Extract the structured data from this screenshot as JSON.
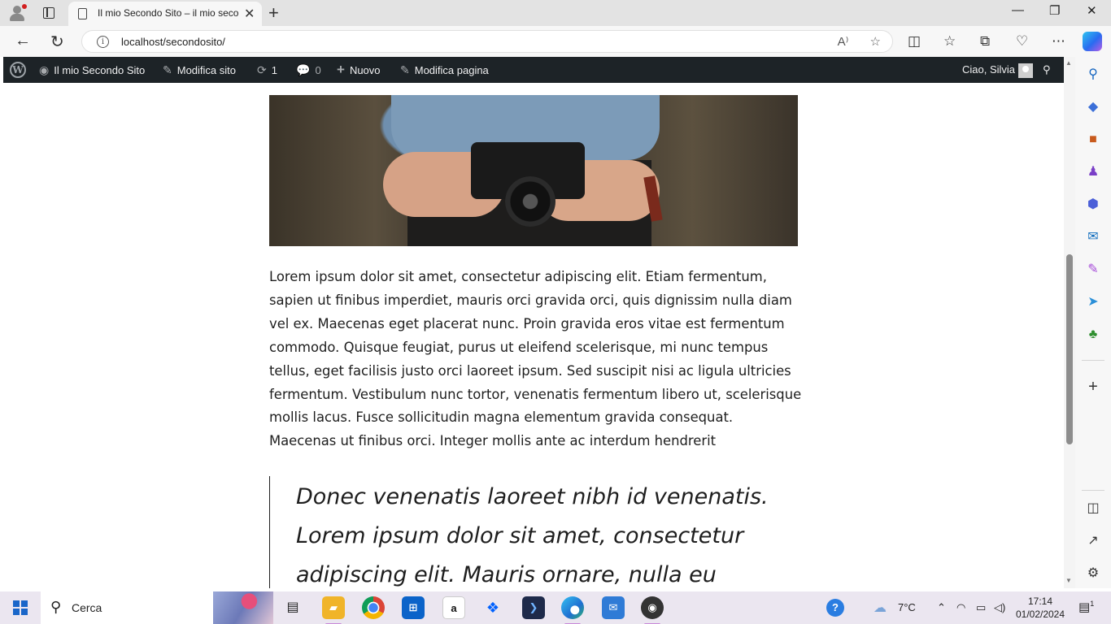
{
  "browser": {
    "tab_title": "Il mio Secondo Sito – il mio seco",
    "url": "localhost/secondosito/",
    "tab_close": "✕",
    "new_tab": "+",
    "win_minimize": "—",
    "win_restore": "❐",
    "win_close": "✕"
  },
  "adminbar": {
    "site_name": "Il mio Secondo Sito",
    "edit_site": "Modifica sito",
    "updates_count": "1",
    "comments_count": "0",
    "new_label": "Nuovo",
    "edit_page": "Modifica pagina",
    "greeting": "Ciao, Silvia"
  },
  "content": {
    "paragraph": "Lorem ipsum dolor sit amet, consectetur adipiscing elit. Etiam fermentum, sapien ut finibus imperdiet, mauris orci gravida orci, quis dignissim nulla diam vel ex. Maecenas eget placerat nunc. Proin gravida eros vitae est fermentum commodo. Quisque feugiat, purus ut eleifend scelerisque, mi nunc tempus tellus, eget facilisis justo orci laoreet ipsum. Sed suscipit nisi ac ligula ultricies fermentum. Vestibulum nunc tortor, venenatis fermentum libero ut, scelerisque mollis lacus. Fusce sollicitudin magna elementum gravida consequat. Maecenas ut finibus orci. Integer mollis ante ac interdum hendrerit",
    "quote": "Donec venenatis laoreet nibh id venenatis. Lorem ipsum dolor sit amet, consectetur adipiscing elit. Mauris ornare, nulla eu sagittis"
  },
  "taskbar": {
    "search_label": "Cerca",
    "weather": "7°C",
    "time": "17:14",
    "date": "01/02/2024",
    "notifications": "1",
    "amazon_letter": "a"
  },
  "colors": {
    "adminbar_bg": "#1d2327",
    "windows_blue": "#1a66c9"
  }
}
